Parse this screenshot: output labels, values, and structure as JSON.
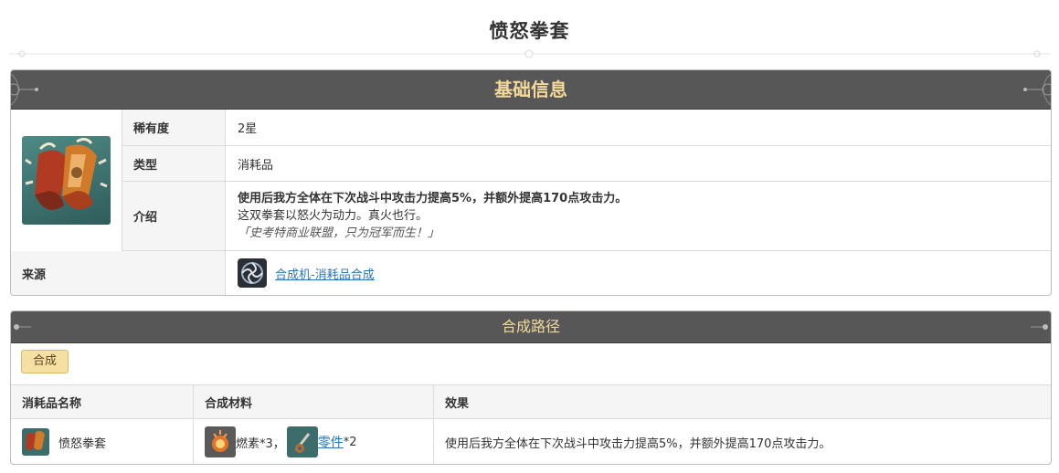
{
  "page": {
    "title": "愤怒拳套"
  },
  "basic_info": {
    "header": "基础信息",
    "rarity_label": "稀有度",
    "rarity_value": "2星",
    "type_label": "类型",
    "type_value": "消耗品",
    "intro_label": "介绍",
    "intro_effect": "使用后我方全体在下次战斗中攻击力提高5%，并额外提高170点攻击力。",
    "intro_desc": "这双拳套以怒火为动力。真火也行。",
    "intro_quote": "「史考特商业联盟，只为冠军而生！」",
    "source_label": "来源",
    "source_link": "合成机-消耗品合成",
    "item_icon": "boxing-gloves-icon",
    "source_icon": "synthesizer-icon"
  },
  "craft": {
    "header": "合成路径",
    "tab_label": "合成",
    "columns": [
      "消耗品名称",
      "合成材料",
      "效果"
    ],
    "rows": [
      {
        "name": "愤怒拳套",
        "mat1_name": "燃素",
        "mat1_qty": "*3，",
        "mat2_name": "零件",
        "mat2_qty": "*2",
        "effect": "使用后我方全体在下次战斗中攻击力提高5%，并额外提高170点攻击力。"
      }
    ]
  },
  "colors": {
    "header_bg": "#575757",
    "header_text": "#f3d99a",
    "link": "#2a74b8",
    "tab_bg": "#f6dfa3"
  }
}
